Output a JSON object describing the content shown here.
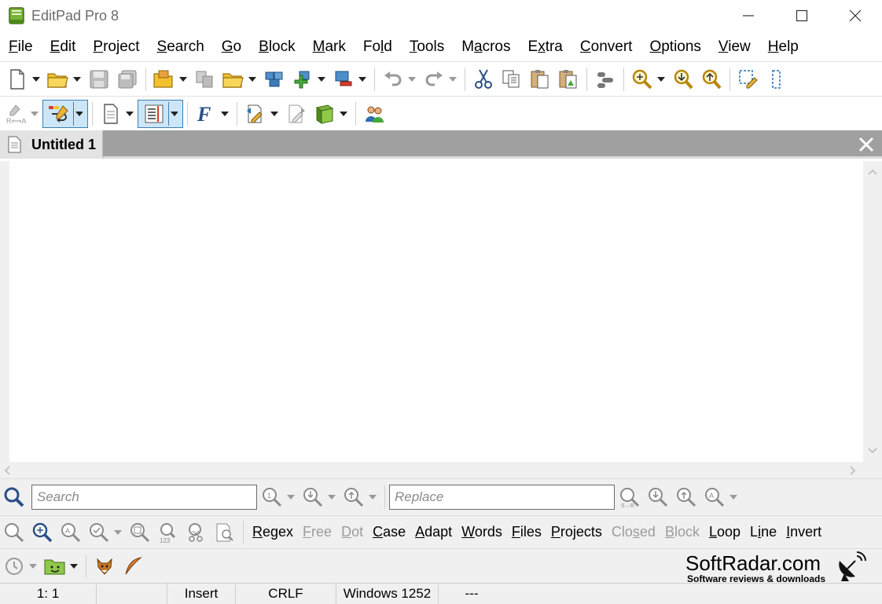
{
  "window": {
    "title": "EditPad Pro 8"
  },
  "menu": [
    "File",
    "Edit",
    "Project",
    "Search",
    "Go",
    "Block",
    "Mark",
    "Fold",
    "Tools",
    "Macros",
    "Extra",
    "Convert",
    "Options",
    "View",
    "Help"
  ],
  "menu_accel": [
    "F",
    "E",
    "P",
    "S",
    "G",
    "B",
    "M",
    "l",
    "T",
    "a",
    "x",
    "C",
    "O",
    "V",
    "H"
  ],
  "tabs": [
    {
      "label": "Untitled 1"
    }
  ],
  "search": {
    "search_placeholder": "Search",
    "replace_placeholder": "Replace",
    "options": [
      {
        "label": "Regex",
        "enabled": true
      },
      {
        "label": "Free",
        "enabled": false
      },
      {
        "label": "Dot",
        "enabled": false
      },
      {
        "label": "Case",
        "enabled": true
      },
      {
        "label": "Adapt",
        "enabled": true
      },
      {
        "label": "Words",
        "enabled": true
      },
      {
        "label": "Files",
        "enabled": true
      },
      {
        "label": "Projects",
        "enabled": true
      },
      {
        "label": "Closed",
        "enabled": false
      },
      {
        "label": "Block",
        "enabled": false
      },
      {
        "label": "Loop",
        "enabled": true
      },
      {
        "label": "Line",
        "enabled": true
      },
      {
        "label": "Invert",
        "enabled": true
      }
    ]
  },
  "status": {
    "position": "1: 1",
    "mode": "Insert",
    "line_break": "CRLF",
    "encoding": "Windows 1252",
    "extra": "---"
  },
  "watermark": {
    "title": "SoftRadar.com",
    "subtitle": "Software reviews & downloads"
  },
  "colors": {
    "accent_blue": "#3c7fb1",
    "folder_yellow": "#f2c12e",
    "tabbar_gray": "#a0a0a0"
  }
}
